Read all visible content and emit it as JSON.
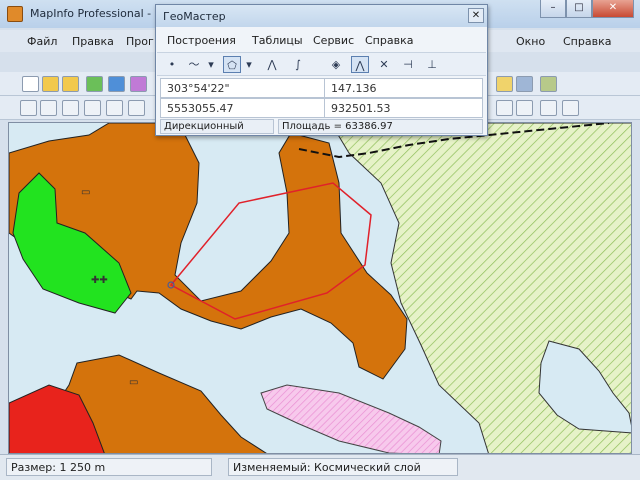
{
  "app": {
    "title": "MapInfo Professional - [",
    "window_buttons": {
      "minimize": "–",
      "maximize": "□",
      "close": "✕"
    }
  },
  "menubar": {
    "left_items": [
      "Файл",
      "Правка",
      "Прог"
    ],
    "right_items": [
      "Окно",
      "Справка"
    ],
    "doc_controls": {
      "minimize": "–",
      "restore": "❐",
      "close": "✕"
    }
  },
  "geomaster": {
    "title": "ГеоМастер",
    "close": "✕",
    "menu": [
      "Построения",
      "Таблицы",
      "Сервис",
      "Справка"
    ],
    "tool_icons": [
      "point-icon",
      "polyline-icon",
      "dropdown-icon",
      "polygon-icon",
      "dropdown-icon",
      "spline-icon",
      "arc-icon",
      "node-icon",
      "vertex-icon",
      "perpendicular-icon",
      "split-icon",
      "base-icon"
    ],
    "row1": {
      "angle": "303°54'22\"",
      "distance": "147.136"
    },
    "row2": {
      "x": "5553055.47",
      "y": "932501.53"
    },
    "footer": {
      "mode": "Дирекционный",
      "area": "Площадь = 63386.97"
    }
  },
  "status": {
    "scale": "Размер: 1 250 m",
    "layer": "Изменяемый: Космический слой"
  },
  "colors": {
    "water": "#d7eaf3",
    "orange_region": "#d4730c",
    "green_region": "#22e31f",
    "red_region": "#e8231c",
    "pink_region": "#f3a8e2",
    "hatch_region": "#e6f2c8",
    "drawn_polygon": "#e0212a"
  }
}
